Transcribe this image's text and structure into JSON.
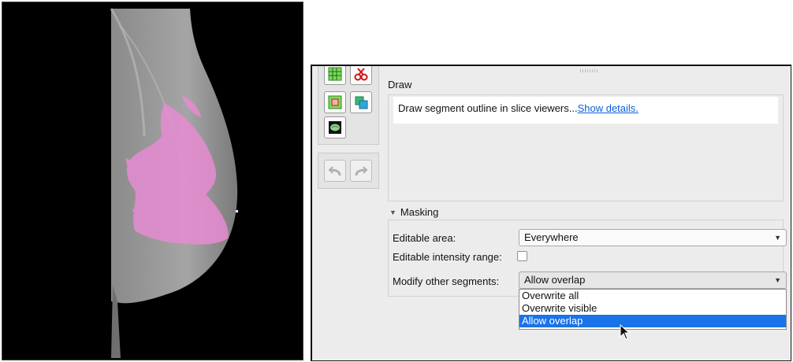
{
  "draw": {
    "title": "Draw",
    "description": "Draw segment outline in slice viewers...",
    "details_link": "Show details."
  },
  "masking": {
    "title": "Masking",
    "editable_area_label": "Editable area:",
    "editable_area_value": "Everywhere",
    "intensity_label": "Editable intensity range:",
    "intensity_checked": false,
    "modify_label": "Modify other segments:",
    "modify_value": "Allow overlap",
    "modify_options": [
      "Overwrite all",
      "Overwrite visible",
      "Allow overlap"
    ],
    "modify_selected_index": 2
  },
  "colors": {
    "segment": "#e68cd2",
    "selection": "#1a73e8",
    "link": "#0a5fd6"
  },
  "icons": [
    "grid-effect-icon",
    "scissors-icon",
    "margin-effect-icon",
    "copy-segment-icon",
    "brain-view-icon",
    "undo-icon",
    "redo-icon",
    "dropdown-arrow-icon",
    "mouse-cursor-icon"
  ]
}
